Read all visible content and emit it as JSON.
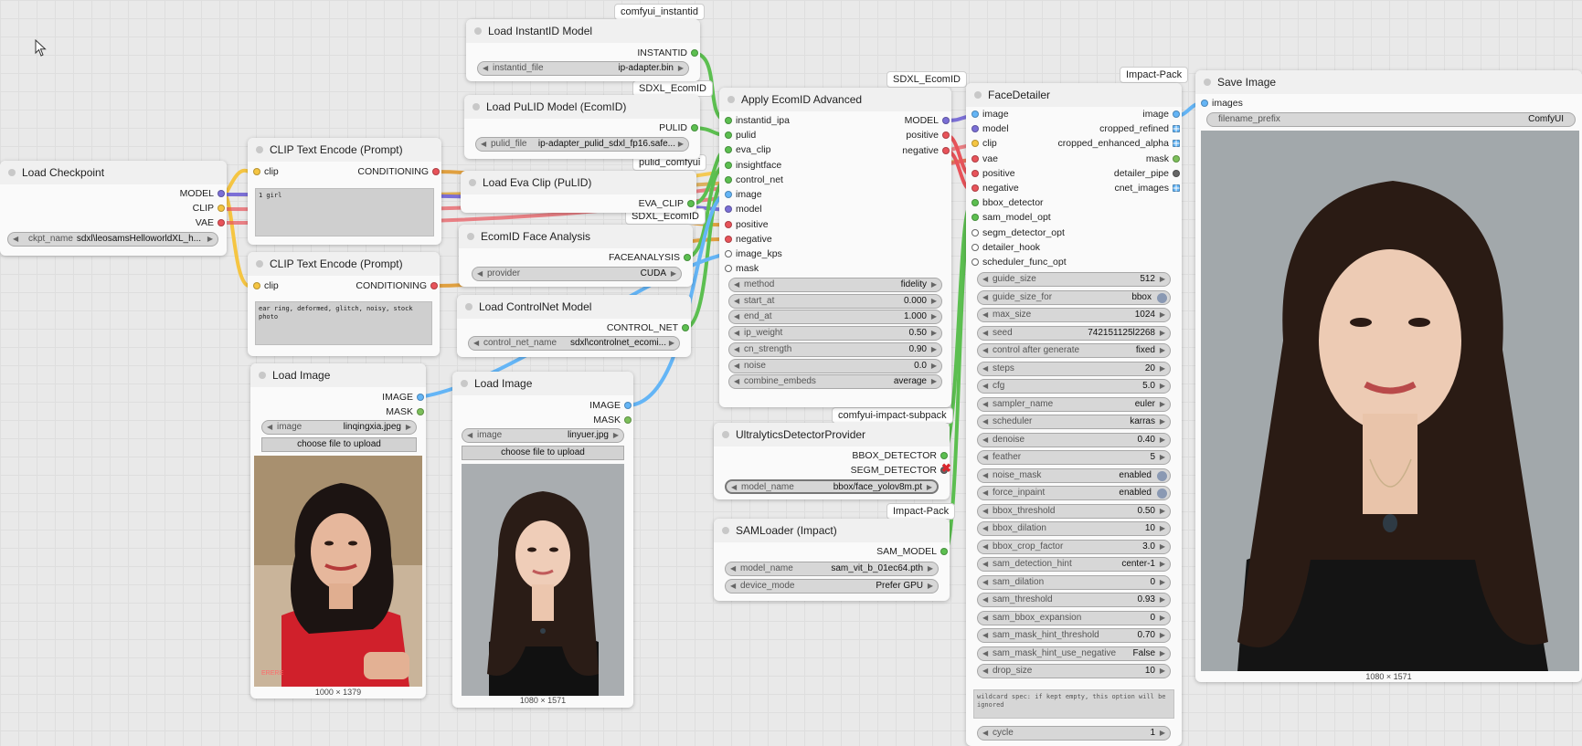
{
  "colors": {
    "model": "#7b6fd6",
    "clip": "#f5c542",
    "vae": "#e8535a",
    "conditioning": "#e0a040",
    "image": "#64b5f6",
    "mask": "#7cbf5a",
    "green": "#5cbf50",
    "pink": "#e8535a"
  },
  "badges": {
    "instantid": "comfyui_instantid",
    "sdxl1": "SDXL_EcomID",
    "pulid": "pulid_comfyui",
    "sdxl2": "SDXL_EcomID",
    "sdxl3": "SDXL_EcomID",
    "impact1": "Impact-Pack",
    "impact_sub": "comfyui-impact-subpack",
    "impact2": "Impact-Pack"
  },
  "load_checkpoint": {
    "title": "Load Checkpoint",
    "outputs": [
      "MODEL",
      "CLIP",
      "VAE"
    ],
    "ckpt_label": "ckpt_name",
    "ckpt_value": "sdxl\\leosamsHelloworldXL_h..."
  },
  "clip1": {
    "title": "CLIP Text Encode (Prompt)",
    "input": "clip",
    "output": "CONDITIONING",
    "text": "1 girl"
  },
  "clip2": {
    "title": "CLIP Text Encode (Prompt)",
    "input": "clip",
    "output": "CONDITIONING",
    "text": "ear ring, deformed, glitch, noisy, stock photo"
  },
  "load_image1": {
    "title": "Load Image",
    "outputs": [
      "IMAGE",
      "MASK"
    ],
    "image_label": "image",
    "image_value": "linqingxia.jpeg",
    "upload": "choose file to upload",
    "caption": "1000 × 1379"
  },
  "load_image2": {
    "title": "Load Image",
    "outputs": [
      "IMAGE",
      "MASK"
    ],
    "image_label": "image",
    "image_value": "linyuer.jpg",
    "upload": "choose file to upload",
    "caption": "1080 × 1571"
  },
  "instantid": {
    "title": "Load InstantID Model",
    "output": "INSTANTID",
    "w_label": "instantid_file",
    "w_value": "ip-adapter.bin"
  },
  "pulid": {
    "title": "Load PuLID Model (EcomID)",
    "output": "PULID",
    "w_label": "pulid_file",
    "w_value": "ip-adapter_pulid_sdxl_fp16.safe..."
  },
  "evaclip": {
    "title": "Load Eva Clip (PuLID)",
    "output": "EVA_CLIP"
  },
  "faceanalysis": {
    "title": "EcomID Face Analysis",
    "output": "FACEANALYSIS",
    "w_label": "provider",
    "w_value": "CUDA"
  },
  "controlnet": {
    "title": "Load ControlNet Model",
    "output": "CONTROL_NET",
    "w_label": "control_net_name",
    "w_value": "sdxl\\controlnet_ecomi..."
  },
  "apply": {
    "title": "Apply EcomID Advanced",
    "inputs": [
      "instantid_ipa",
      "pulid",
      "eva_clip",
      "insightface",
      "control_net",
      "image",
      "model",
      "positive",
      "negative",
      "image_kps",
      "mask"
    ],
    "outputs": [
      "MODEL",
      "positive",
      "negative"
    ],
    "widgets": [
      {
        "label": "method",
        "value": "fidelity"
      },
      {
        "label": "start_at",
        "value": "0.000"
      },
      {
        "label": "end_at",
        "value": "1.000"
      },
      {
        "label": "ip_weight",
        "value": "0.50"
      },
      {
        "label": "cn_strength",
        "value": "0.90"
      },
      {
        "label": "noise",
        "value": "0.0"
      },
      {
        "label": "combine_embeds",
        "value": "average"
      }
    ]
  },
  "ultralytics": {
    "title": "UltralyticsDetectorProvider",
    "outputs": [
      "BBOX_DETECTOR",
      "SEGM_DETECTOR"
    ],
    "w_label": "model_name",
    "w_value": "bbox/face_yolov8m.pt"
  },
  "samloader": {
    "title": "SAMLoader (Impact)",
    "output": "SAM_MODEL",
    "widgets": [
      {
        "label": "model_name",
        "value": "sam_vit_b_01ec64.pth"
      },
      {
        "label": "device_mode",
        "value": "Prefer GPU"
      }
    ]
  },
  "facedetailer": {
    "title": "FaceDetailer",
    "inputs": [
      "image",
      "model",
      "clip",
      "vae",
      "positive",
      "negative",
      "bbox_detector",
      "sam_model_opt",
      "segm_detector_opt",
      "detailer_hook",
      "scheduler_func_opt"
    ],
    "outputs": [
      "image",
      "cropped_refined",
      "cropped_enhanced_alpha",
      "mask",
      "detailer_pipe",
      "cnet_images"
    ],
    "widgets": [
      {
        "label": "guide_size",
        "value": "512"
      },
      {
        "label": "guide_size_for",
        "value": "bbox",
        "toggle": true
      },
      {
        "label": "max_size",
        "value": "1024"
      },
      {
        "label": "seed",
        "value": "742151125l2268"
      },
      {
        "label": "control after generate",
        "value": "fixed"
      },
      {
        "label": "steps",
        "value": "20"
      },
      {
        "label": "cfg",
        "value": "5.0"
      },
      {
        "label": "sampler_name",
        "value": "euler"
      },
      {
        "label": "scheduler",
        "value": "karras"
      },
      {
        "label": "denoise",
        "value": "0.40"
      },
      {
        "label": "feather",
        "value": "5"
      },
      {
        "label": "noise_mask",
        "value": "enabled",
        "toggle": true
      },
      {
        "label": "force_inpaint",
        "value": "enabled",
        "toggle": true
      },
      {
        "label": "bbox_threshold",
        "value": "0.50"
      },
      {
        "label": "bbox_dilation",
        "value": "10"
      },
      {
        "label": "bbox_crop_factor",
        "value": "3.0"
      },
      {
        "label": "sam_detection_hint",
        "value": "center-1"
      },
      {
        "label": "sam_dilation",
        "value": "0"
      },
      {
        "label": "sam_threshold",
        "value": "0.93"
      },
      {
        "label": "sam_bbox_expansion",
        "value": "0"
      },
      {
        "label": "sam_mask_hint_threshold",
        "value": "0.70"
      },
      {
        "label": "sam_mask_hint_use_negative",
        "value": "False"
      },
      {
        "label": "drop_size",
        "value": "10"
      }
    ],
    "wildcard_note": "wildcard spec: if kept empty, this option will be ignored",
    "cycle_label": "cycle",
    "cycle_value": "1"
  },
  "save_image": {
    "title": "Save Image",
    "input": "images",
    "w_label": "filename_prefix",
    "w_value": "ComfyUI",
    "caption": "1080 × 1571"
  }
}
